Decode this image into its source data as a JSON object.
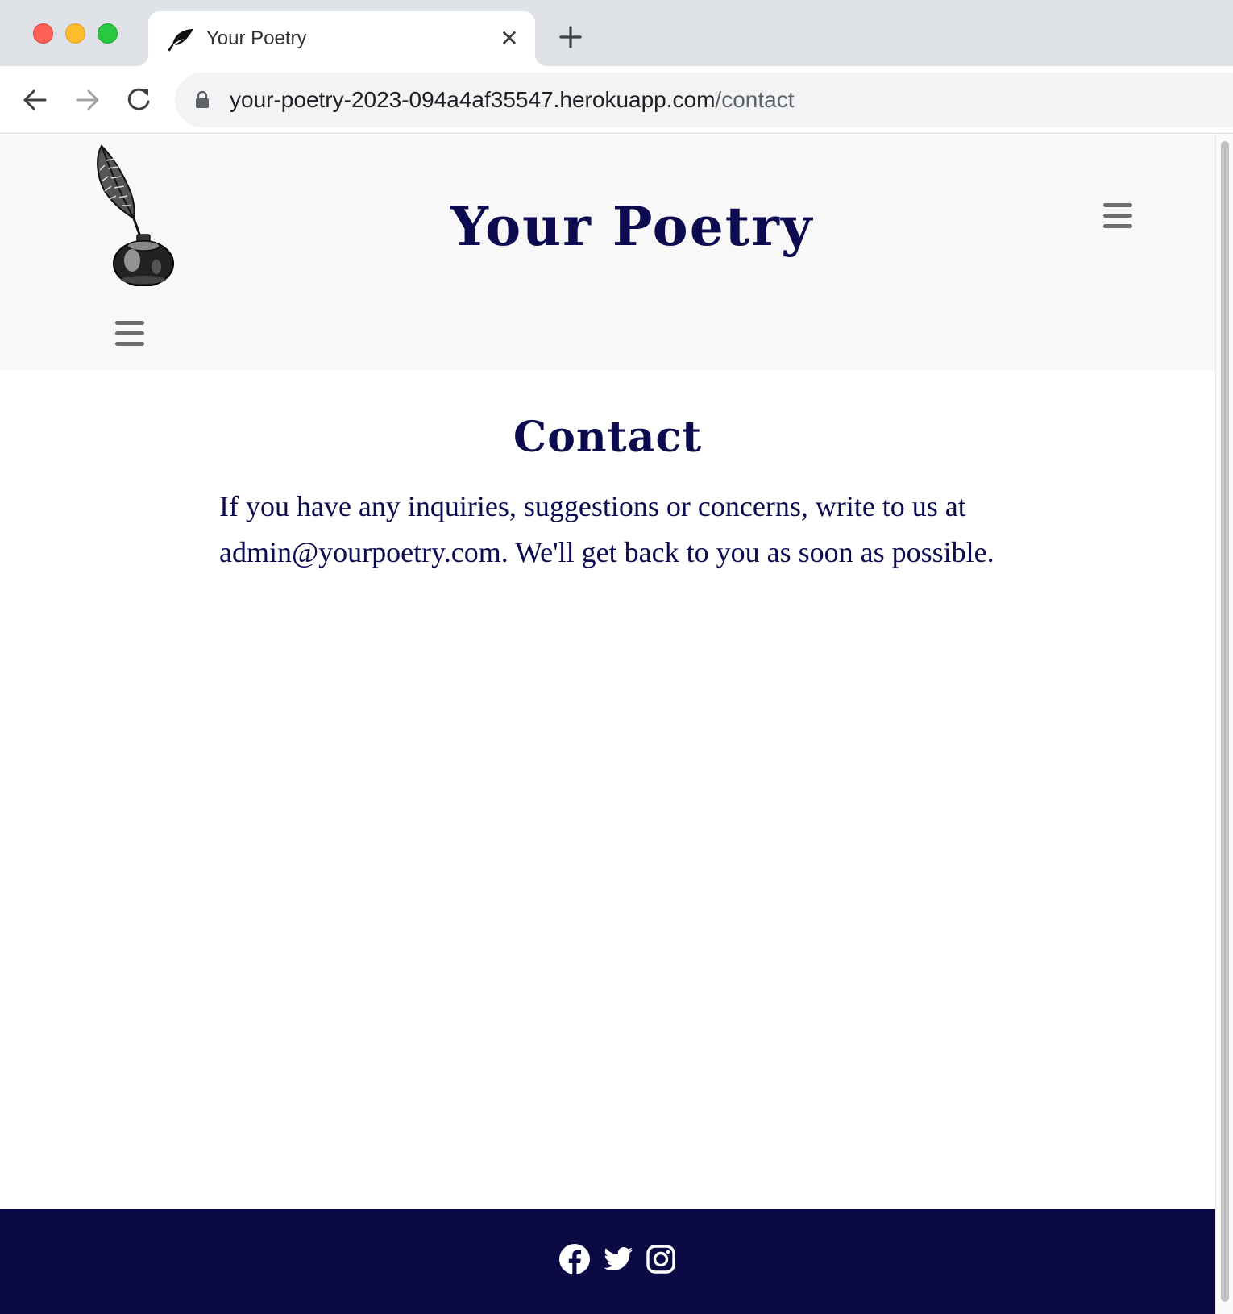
{
  "browser": {
    "tab": {
      "title": "Your Poetry",
      "favicon": "quill-icon",
      "close_glyph": "✕"
    },
    "new_tab_icon": "plus-icon",
    "nav": {
      "back_icon": "arrow-left-icon",
      "forward_icon": "arrow-right-icon",
      "reload_icon": "reload-icon"
    },
    "address": {
      "lock_icon": "lock-icon",
      "host": "your-poetry-2023-094a4af35547.herokuapp.com",
      "path": "/contact"
    }
  },
  "site": {
    "title": "Your Poetry",
    "logo": "quill-and-inkwell-logo",
    "menu_icon": "hamburger-icon",
    "colors": {
      "primary": "#0d0b50",
      "header_bg": "#f8f8f8",
      "footer_bg": "#0b0a45"
    }
  },
  "main": {
    "heading": "Contact",
    "body": "If you have any inquiries, suggestions or concerns, write to us at admin@yourpoetry.com. We'll get back to you as soon as possible."
  },
  "footer": {
    "social": [
      {
        "icon": "facebook-icon"
      },
      {
        "icon": "twitter-icon"
      },
      {
        "icon": "instagram-icon"
      }
    ]
  }
}
